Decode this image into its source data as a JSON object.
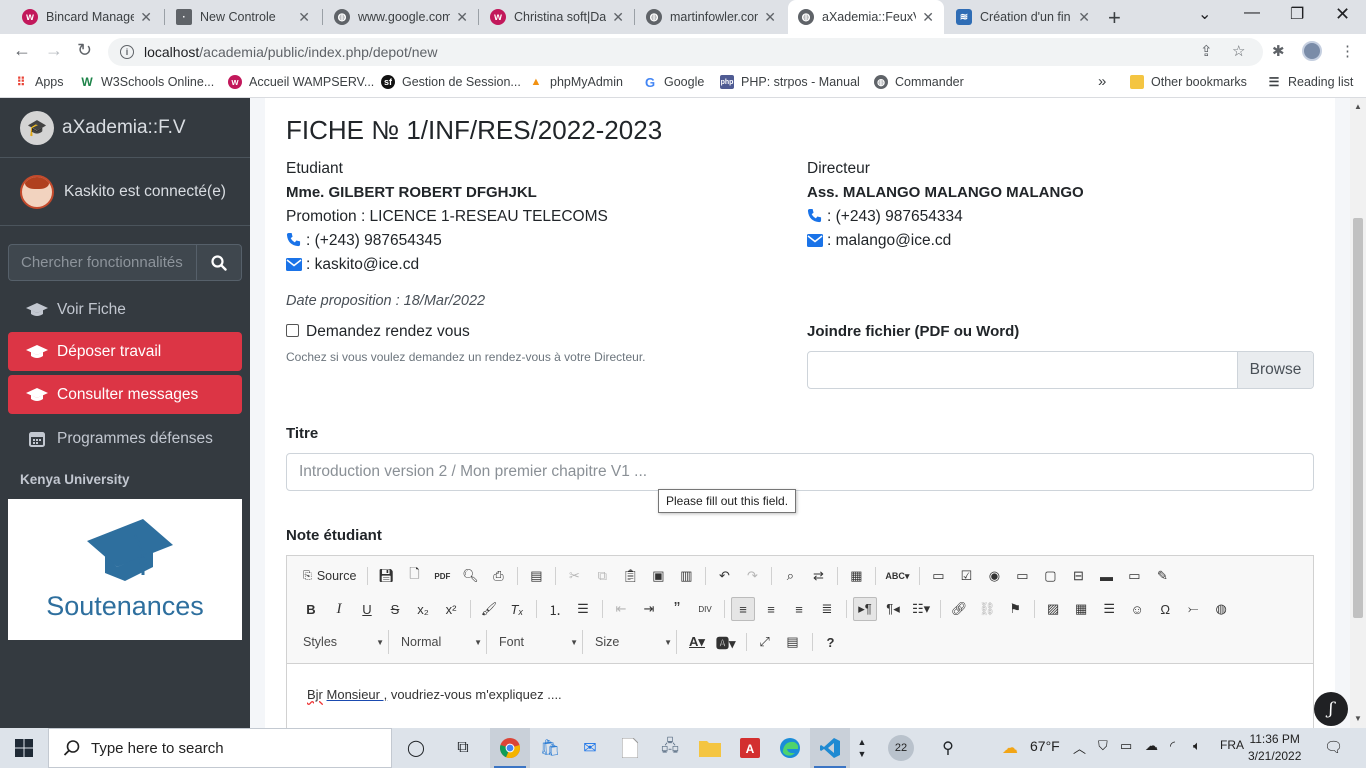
{
  "browser": {
    "tabs": [
      {
        "title": "Bincard Managem",
        "icon": "wamp-icon",
        "color": "#c2185b"
      },
      {
        "title": "New Controle",
        "icon": "page-icon",
        "color": "#5f6368"
      },
      {
        "title": "www.google.com",
        "icon": "globe-icon",
        "color": "#5f6368"
      },
      {
        "title": "Christina soft|Da",
        "icon": "wamp-icon",
        "color": "#c2185b"
      },
      {
        "title": "martinfowler.com",
        "icon": "globe-icon",
        "color": "#5f6368"
      },
      {
        "title": "aXademia::FeuxV",
        "icon": "globe-icon",
        "color": "#5f6368"
      },
      {
        "title": "Création d'un fin",
        "icon": "stack-icon",
        "color": "#2f6db5"
      }
    ],
    "url_host": "localhost",
    "url_path": "/academia/public/index.php/depot/new",
    "bookmarks": [
      {
        "label": "Apps",
        "icon": "apps-grid-icon"
      },
      {
        "label": "W3Schools Online...",
        "icon": "w3schools-icon"
      },
      {
        "label": "Accueil WAMPSERV...",
        "icon": "wamp-icon"
      },
      {
        "label": "Gestion de Session...",
        "icon": "symfony-icon"
      },
      {
        "label": "phpMyAdmin",
        "icon": "phpmyadmin-icon"
      },
      {
        "label": "Google",
        "icon": "google-icon"
      },
      {
        "label": "PHP: strpos - Manual",
        "icon": "php-icon"
      },
      {
        "label": "Commander",
        "icon": "globe-icon"
      }
    ],
    "other_bookmarks": "Other bookmarks",
    "reading_list": "Reading list",
    "more_bookmarks": "»"
  },
  "sidebar": {
    "brand": "aXademia::F.V",
    "user": "Kaskito est connecté(e)",
    "search_placeholder": "Chercher fonctionnalités",
    "items": [
      {
        "label": "Voir Fiche",
        "active": false
      },
      {
        "label": "Déposer travail",
        "active": true
      },
      {
        "label": "Consulter messages",
        "active": true
      },
      {
        "label": "Programmes défenses",
        "active": false
      }
    ],
    "section_header": "Kenya University",
    "image_caption": "Soutenances"
  },
  "main": {
    "title": "FICHE № 1/INF/RES/2022-2023",
    "student": {
      "heading": "Etudiant",
      "name": "Mme. GILBERT ROBERT DFGHJKL",
      "promotion": "Promotion : LICENCE 1-RESEAU TELECOMS",
      "phone": ": (+243) 987654345",
      "email": ": kaskito@ice.cd"
    },
    "director": {
      "heading": "Directeur",
      "name": "Ass. MALANGO MALANGO MALANGO",
      "phone": ": (+243) 987654334",
      "email": ": malango@ice.cd"
    },
    "date_proposition": "Date proposition : 18/Mar/2022",
    "rdv_label": "Demandez rendez vous",
    "rdv_help": "Cochez si vous voulez demandez un rendez-vous à votre Directeur.",
    "file_label": "Joindre fichier (PDF ou Word)",
    "file_browse": "Browse",
    "title_label": "Titre",
    "title_placeholder": "Introduction version 2 / Mon premier chapitre V1 ...",
    "tooltip": "Please fill out this field.",
    "note_label": "Note étudiant"
  },
  "editor": {
    "source_label": "Source",
    "styles_label": "Styles",
    "format_label": "Normal",
    "font_label": "Font",
    "size_label": "Size",
    "content_word1": "Bjr",
    "content_word2": "Monsieur ,",
    "content_rest": " voudriez-vous m'expliquez ...."
  },
  "taskbar": {
    "search_placeholder": "Type here to search",
    "badge": "22",
    "weather": "67°F",
    "lang": "FRA",
    "time": "11:36 PM",
    "date": "3/21/2022"
  }
}
